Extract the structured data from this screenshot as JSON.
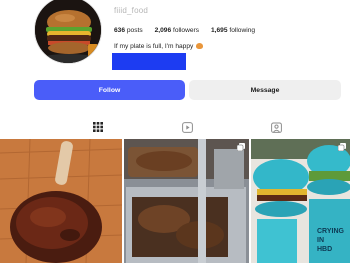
{
  "profile": {
    "username": "fiiid_food",
    "avatar_icon": "burger-avatar",
    "stats": {
      "posts_value": "636",
      "posts_label": "posts",
      "followers_value": "2,096",
      "followers_label": "followers",
      "following_value": "1,695",
      "following_label": "following"
    },
    "bio": "If my plate is full, I'm happy",
    "bio_emoji_icon": "smiling-face-icon",
    "link_color": "#1d3cf2"
  },
  "actions": {
    "follow_label": "Follow",
    "message_label": "Message",
    "follow_color": "#4a5df9"
  },
  "tabs": [
    {
      "name": "posts",
      "icon": "grid-icon",
      "active": true
    },
    {
      "name": "reels",
      "icon": "reels-icon",
      "active": false
    },
    {
      "name": "tagged",
      "icon": "tagged-icon",
      "active": false
    }
  ],
  "posts": [
    {
      "subject": "grilled tomahawk steak on wooden board",
      "multi": false
    },
    {
      "subject": "braised meat in steel tray",
      "multi": true
    },
    {
      "subject": "blue burger buns with cups",
      "multi": true
    }
  ],
  "posts_cup_text": "CRYING IN HBD"
}
